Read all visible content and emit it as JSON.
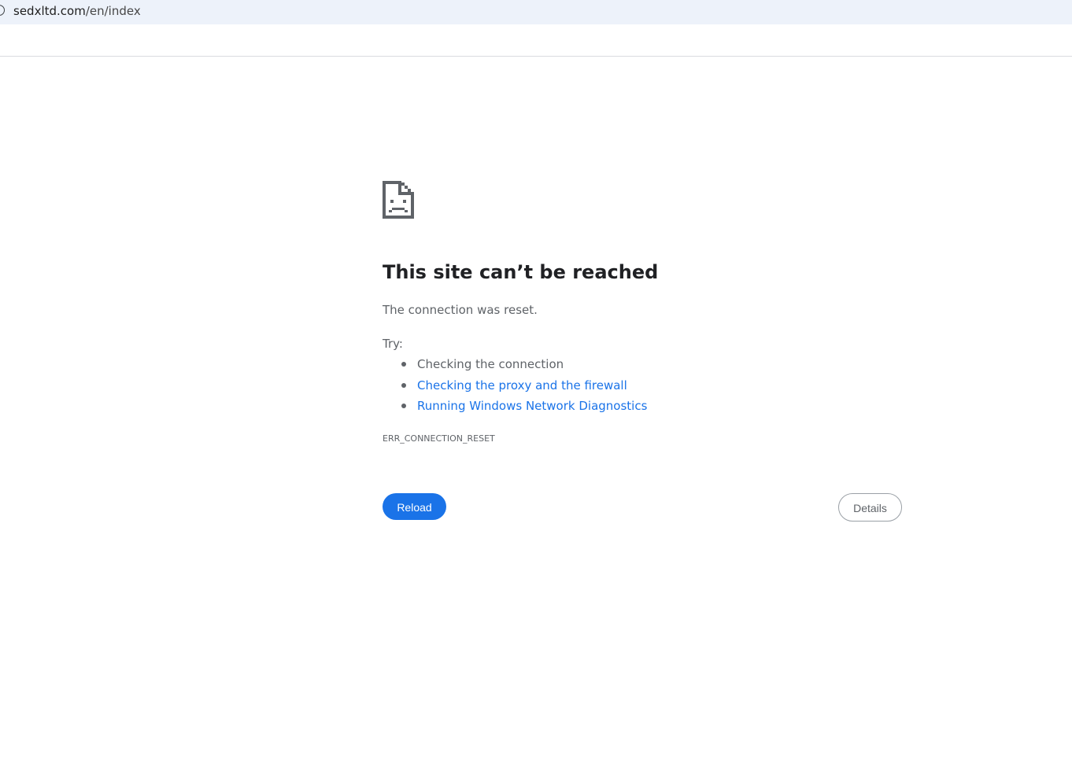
{
  "browser": {
    "url_host": "sedxltd.com",
    "url_path": "/en/index",
    "site_info_icon": "info-circle-icon"
  },
  "error_page": {
    "icon": "sad-page-icon",
    "title": "This site can’t be reached",
    "summary": "The connection was reset.",
    "try_label": "Try:",
    "suggestions": [
      {
        "text": "Checking the connection",
        "is_link": false
      },
      {
        "text": "Checking the proxy and the firewall",
        "is_link": true
      },
      {
        "text": "Running Windows Network Diagnostics",
        "is_link": true
      }
    ],
    "error_code": "ERR_CONNECTION_RESET",
    "reload_label": "Reload",
    "details_label": "Details"
  },
  "colors": {
    "link": "#1a73e8",
    "primary_button": "#1a73e8",
    "text_primary": "#202124",
    "text_secondary": "#5f6368",
    "address_bar_bg": "#edf2fa"
  }
}
